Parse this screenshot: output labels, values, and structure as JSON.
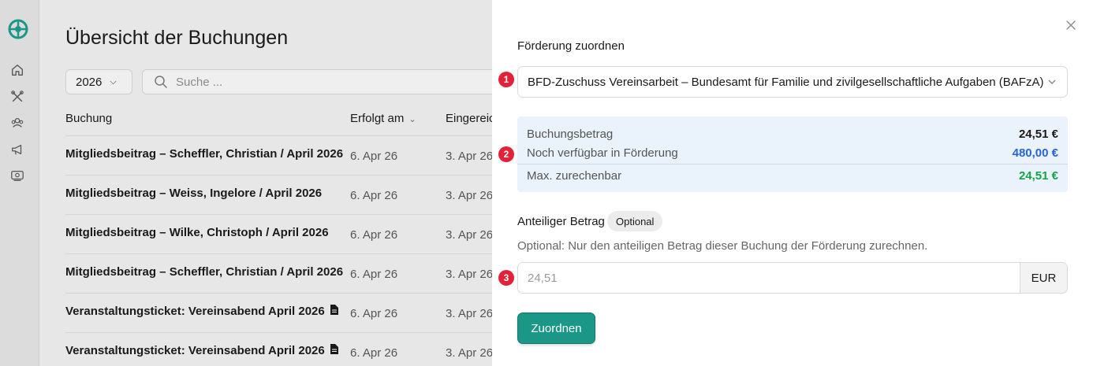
{
  "sidebar": {
    "logo": "app-logo",
    "items": [
      "home-icon",
      "tools-icon",
      "members-icon",
      "megaphone-icon",
      "finance-icon"
    ]
  },
  "main": {
    "title": "Übersicht der Buchungen",
    "year": "2026",
    "search_placeholder": "Suche ...",
    "columns": {
      "buchung": "Buchung",
      "erfolgt": "Erfolgt am",
      "eingereicht": "Eingereic"
    },
    "rows": [
      {
        "name": "Mitgliedsbeitrag – Scheffler, Christian / April 2026",
        "date1": "6. Apr 26",
        "date2": "3. Apr 26",
        "doc": false
      },
      {
        "name": "Mitgliedsbeitrag – Weiss, Ingelore / April 2026",
        "date1": "6. Apr 26",
        "date2": "3. Apr 26",
        "doc": false
      },
      {
        "name": "Mitgliedsbeitrag – Wilke, Christoph / April 2026",
        "date1": "6. Apr 26",
        "date2": "3. Apr 26",
        "doc": false
      },
      {
        "name": "Mitgliedsbeitrag – Scheffler, Christian / April 2026",
        "date1": "6. Apr 26",
        "date2": "3. Apr 26",
        "doc": false
      },
      {
        "name": "Veranstaltungsticket: Vereinsabend April 2026",
        "date1": "6. Apr 26",
        "date2": "3. Apr 26",
        "doc": true
      },
      {
        "name": "Veranstaltungsticket: Vereinsabend April 2026",
        "date1": "6. Apr 26",
        "date2": "3. Apr 26",
        "doc": true
      }
    ]
  },
  "panel": {
    "title": "Förderung zuordnen",
    "markers": [
      "1",
      "2",
      "3"
    ],
    "funding_select": "BFD-Zuschuss Vereinsarbeit – Bundesamt für Familie und zivilgesellschaftliche Aufgaben (BAFzA)",
    "summary": {
      "booking_label": "Buchungsbetrag",
      "booking_value": "24,51 €",
      "available_label": "Noch verfügbar in Förderung",
      "available_value": "480,00 €",
      "max_label": "Max. zurechenbar",
      "max_value": "24,51 €"
    },
    "amount_label": "Anteiliger Betrag",
    "optional_badge": "Optional",
    "help_text": "Optional: Nur den anteiligen Betrag dieser Buchung der Förderung zurechnen.",
    "amount_placeholder": "24,51",
    "unit": "EUR",
    "submit": "Zuordnen"
  },
  "colors": {
    "accent": "#1a9786",
    "marker": "#e3223a",
    "blue": "#2563d6",
    "green": "#16a34a",
    "summary_bg": "#eaf2fb"
  }
}
